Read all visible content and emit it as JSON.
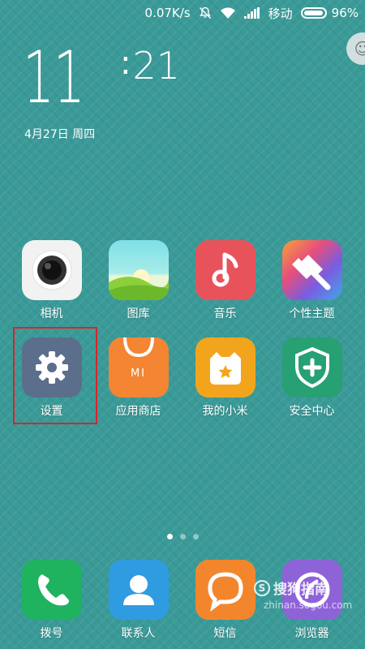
{
  "status_bar": {
    "speed": "0.07K/s",
    "carrier": "移动",
    "battery": "96%"
  },
  "lock": {
    "hours": "11",
    "minutes": "21",
    "date": "4月27日 周四"
  },
  "apps": [
    {
      "id": "camera",
      "label": "相机"
    },
    {
      "id": "gallery",
      "label": "图库"
    },
    {
      "id": "music",
      "label": "音乐"
    },
    {
      "id": "themes",
      "label": "个性主题"
    },
    {
      "id": "settings",
      "label": "设置"
    },
    {
      "id": "app-store",
      "label": "应用商店",
      "glyph": "MI"
    },
    {
      "id": "mi-community",
      "label": "我的小米"
    },
    {
      "id": "security",
      "label": "安全中心"
    }
  ],
  "dock": [
    {
      "id": "phone",
      "label": "拨号"
    },
    {
      "id": "contacts",
      "label": "联系人"
    },
    {
      "id": "messages",
      "label": "短信"
    },
    {
      "id": "browser",
      "label": "浏览器"
    }
  ],
  "watermark": {
    "logo": "S",
    "brand": "搜狗指南",
    "url": "zhinan.sogou.com"
  },
  "colors": {
    "wallpaper": "#3a9a98",
    "highlight": "#d7252b",
    "settings_icon": "#5b6f8c",
    "store_icon": "#f38533",
    "security_icon": "#27a074",
    "phone_icon": "#1fb25f",
    "contacts_icon": "#2f9be0",
    "messages_icon": "#f3862c",
    "browser_icon": "#8e63d8"
  }
}
